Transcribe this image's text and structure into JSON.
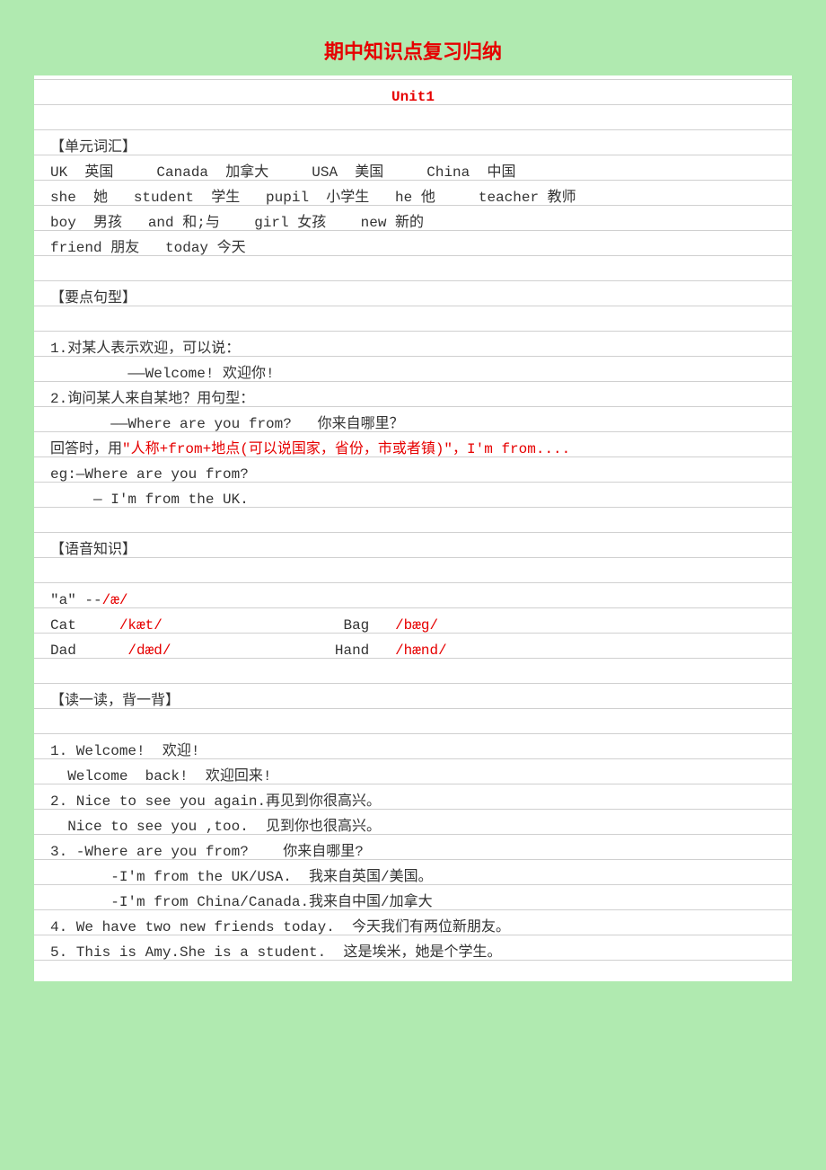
{
  "page_title": "期中知识点复习归纳",
  "unit_heading": "Unit1",
  "sections": {
    "vocab_header": "【单元词汇】",
    "vocab_line1": "UK  英国     Canada  加拿大     USA  美国     China  中国",
    "vocab_line2": "she  她   student  学生   pupil  小学生   he 他     teacher 教师",
    "vocab_line3": "boy  男孩   and 和;与    girl 女孩    new 新的",
    "vocab_line4": "friend 朋友   today 今天",
    "sentence_header": "【要点句型】",
    "s1_label": "1.对某人表示欢迎，可以说：",
    "s1_example": "         ——Welcome! 欢迎你!",
    "s2_label": "2.询问某人来自某地？用句型：",
    "s2_example": "       ——Where are you from?   你来自哪里？",
    "s2_reply_prefix": "回答时，用",
    "s2_reply_red": "\"人称+from+地点(可以说国家，省份，市或者镇)\"，I'm from....",
    "s2_eg1": "eg:—Where are you from?",
    "s2_eg2": "     — I'm from the UK.",
    "phonics_header": "【语音知识】",
    "ph_a_prefix": "\"a\" --",
    "ph_a_red": "/æ/",
    "ph_cat_label": "Cat     ",
    "ph_cat_red": "/kæt/",
    "ph_bag_label": "                     Bag   ",
    "ph_bag_red": "/bæg/",
    "ph_dad_label": "Dad      ",
    "ph_dad_red": "/dæd/",
    "ph_hand_label": "                   Hand   ",
    "ph_hand_red": "/hænd/",
    "read_header": "【读一读，背一背】",
    "r1": "1. Welcome!  欢迎!",
    "r1b": "  Welcome  back!  欢迎回来!",
    "r2": "2. Nice to see you again.再见到你很高兴。",
    "r2b": "  Nice to see you ,too.  见到你也很高兴。",
    "r3": "3. -Where are you from?    你来自哪里?",
    "r3b": "       -I'm from the UK/USA.  我来自英国/美国。",
    "r3c": "       -I'm from China/Canada.我来自中国/加拿大",
    "r4": "4. We have two new friends today.  今天我们有两位新朋友。",
    "r5": "5. This is Amy.She is a student.  这是埃米，她是个学生。"
  }
}
